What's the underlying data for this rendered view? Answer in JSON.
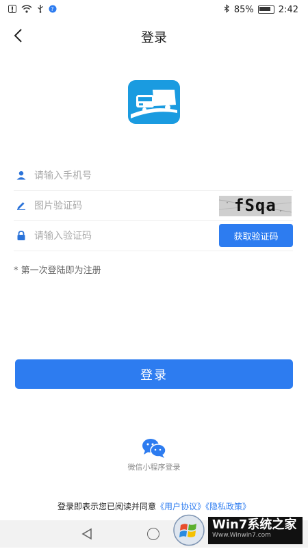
{
  "status_bar": {
    "left_icons": [
      "notification-icon",
      "wifi-icon",
      "usb-icon",
      "app-badge-icon"
    ],
    "bluetooth_icon": "bluetooth-icon",
    "battery_percent": "85%",
    "time": "2:42"
  },
  "header": {
    "title": "登录",
    "back_icon": "back-arrow-icon"
  },
  "logo": {
    "icon": "truck-logo-icon",
    "brand_color": "#1a9be0"
  },
  "form": {
    "phone": {
      "placeholder": "请输入手机号",
      "value": "",
      "icon": "user-icon"
    },
    "captcha": {
      "placeholder": "图片验证码",
      "value": "",
      "icon": "pencil-icon",
      "image_text": "fSqa"
    },
    "sms_code": {
      "placeholder": "请输入验证码",
      "value": "",
      "icon": "lock-icon",
      "button_label": "获取验证码"
    },
    "note": "* 第一次登陆即为注册"
  },
  "login_button": {
    "label": "登录"
  },
  "wechat": {
    "icon": "wechat-icon",
    "label": "微信小程序登录"
  },
  "agreement": {
    "prefix": "登录即表示您已阅读并同意",
    "user_agreement": "《用户协议》",
    "privacy_policy": "《隐私政策》"
  },
  "colors": {
    "accent": "#2d7cf0",
    "icon_blue": "#2b73d9"
  },
  "watermark": {
    "text": "Win7系统之家",
    "sub": "Www.Winwin7.com"
  }
}
